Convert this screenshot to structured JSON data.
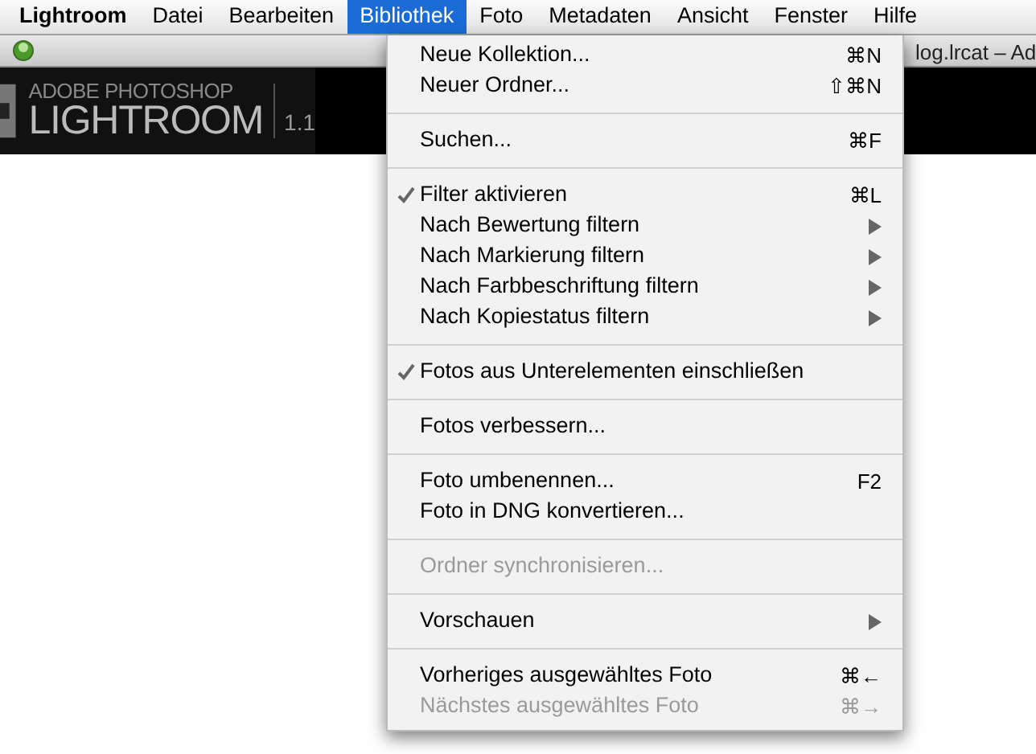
{
  "menubar": [
    {
      "label": "Lightroom",
      "selected": false,
      "app": true
    },
    {
      "label": "Datei",
      "selected": false
    },
    {
      "label": "Bearbeiten",
      "selected": false
    },
    {
      "label": "Bibliothek",
      "selected": true
    },
    {
      "label": "Foto",
      "selected": false
    },
    {
      "label": "Metadaten",
      "selected": false
    },
    {
      "label": "Ansicht",
      "selected": false
    },
    {
      "label": "Fenster",
      "selected": false
    },
    {
      "label": "Hilfe",
      "selected": false
    }
  ],
  "window": {
    "title": "log.lrcat – Ad"
  },
  "logo": {
    "line_1": "ADOBE PHOTOSHOP",
    "line_2": "LIGHTROOM",
    "version": "1.1"
  },
  "menu": [
    {
      "kind": "item",
      "label": "Neue Kollektion...",
      "shortcut": "⌘N",
      "checked": false,
      "disabled": false
    },
    {
      "kind": "item",
      "label": "Neuer Ordner...",
      "shortcut": "⇧⌘N",
      "checked": false,
      "disabled": false
    },
    {
      "kind": "separator"
    },
    {
      "kind": "item",
      "label": "Suchen...",
      "shortcut": "⌘F",
      "checked": false,
      "disabled": false
    },
    {
      "kind": "separator"
    },
    {
      "kind": "item",
      "label": "Filter aktivieren",
      "shortcut": "⌘L",
      "checked": true,
      "disabled": false
    },
    {
      "kind": "submenu",
      "label": "Nach Bewertung filtern",
      "checked": false,
      "disabled": false
    },
    {
      "kind": "submenu",
      "label": "Nach Markierung filtern",
      "checked": false,
      "disabled": false
    },
    {
      "kind": "submenu",
      "label": "Nach Farbbeschriftung filtern",
      "checked": false,
      "disabled": false
    },
    {
      "kind": "submenu",
      "label": "Nach Kopiestatus filtern",
      "checked": false,
      "disabled": false
    },
    {
      "kind": "separator"
    },
    {
      "kind": "item",
      "label": "Fotos aus Unterelementen einschließen",
      "checked": true,
      "disabled": false
    },
    {
      "kind": "separator"
    },
    {
      "kind": "item",
      "label": "Fotos verbessern...",
      "checked": false,
      "disabled": false
    },
    {
      "kind": "separator"
    },
    {
      "kind": "item",
      "label": "Foto umbenennen...",
      "shortcut": "F2",
      "checked": false,
      "disabled": false
    },
    {
      "kind": "item",
      "label": "Foto in DNG konvertieren...",
      "checked": false,
      "disabled": false
    },
    {
      "kind": "separator"
    },
    {
      "kind": "item",
      "label": "Ordner synchronisieren...",
      "checked": false,
      "disabled": true
    },
    {
      "kind": "separator"
    },
    {
      "kind": "submenu",
      "label": "Vorschauen",
      "checked": false,
      "disabled": false
    },
    {
      "kind": "separator"
    },
    {
      "kind": "item",
      "label": "Vorheriges ausgewähltes Foto",
      "shortcut": "⌘←",
      "checked": false,
      "disabled": false
    },
    {
      "kind": "item",
      "label": "Nächstes ausgewähltes Foto",
      "shortcut": "⌘→",
      "checked": false,
      "disabled": true
    }
  ]
}
